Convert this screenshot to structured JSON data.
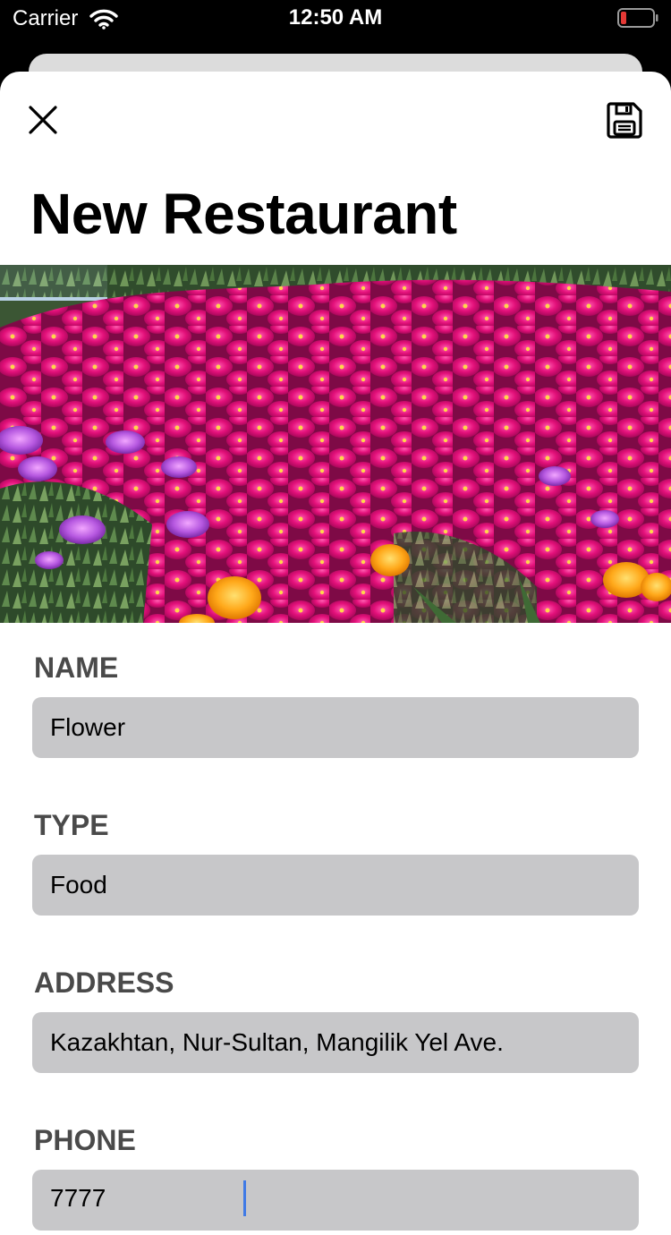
{
  "status_bar": {
    "carrier": "Carrier",
    "time": "12:50 AM"
  },
  "header": {
    "close_icon": "close-icon",
    "save_icon": "floppy-disk-icon",
    "title": "New Restaurant"
  },
  "hero_image": {
    "subject": "flower-field"
  },
  "form": {
    "fields": [
      {
        "label": "NAME",
        "value": "Flower"
      },
      {
        "label": "TYPE",
        "value": "Food"
      },
      {
        "label": "ADDRESS",
        "value": "Kazakhtan, Nur-Sultan, Mangilik Yel Ave."
      },
      {
        "label": "PHONE",
        "value": "7777"
      }
    ]
  },
  "colors": {
    "accent": "#3f7ae6",
    "input_bg": "#c7c7c9",
    "label": "#4a4a4a",
    "battery_low": "#e53935"
  }
}
